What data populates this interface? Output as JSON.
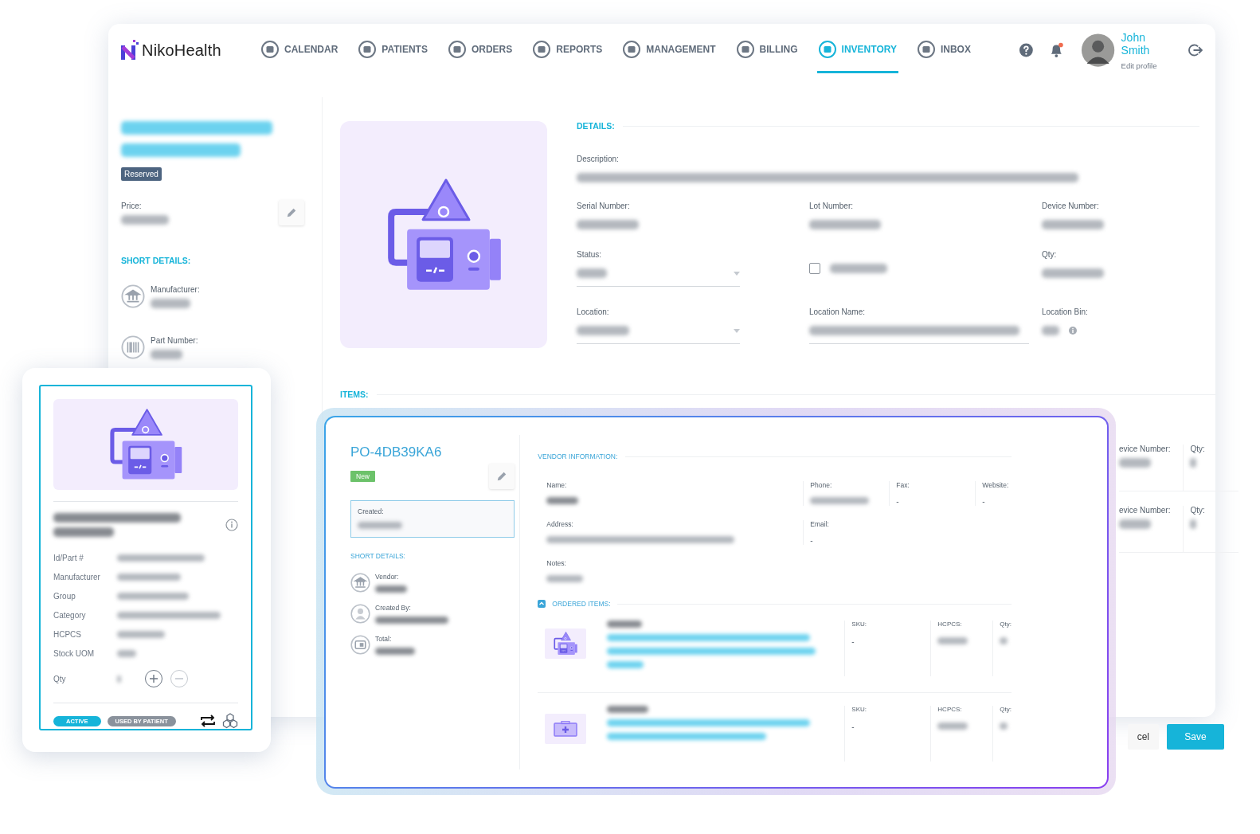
{
  "app": {
    "brand": "NikoHealth"
  },
  "nav": [
    {
      "label": "CALENDAR",
      "selected": false
    },
    {
      "label": "PATIENTS",
      "selected": false
    },
    {
      "label": "ORDERS",
      "selected": false
    },
    {
      "label": "REPORTS",
      "selected": false
    },
    {
      "label": "MANAGEMENT",
      "selected": false
    },
    {
      "label": "BILLING",
      "selected": false
    },
    {
      "label": "INVENTORY",
      "selected": true
    },
    {
      "label": "INBOX",
      "selected": false
    }
  ],
  "user": {
    "name": "John Smith",
    "link": "Edit profile",
    "has_notification": true
  },
  "product": {
    "status_badge": "Reserved",
    "price_label": "Price:",
    "short_details_title": "SHORT DETAILS:",
    "short_details": [
      {
        "label": "Manufacturer:"
      },
      {
        "label": "Part Number:"
      }
    ]
  },
  "details": {
    "title": "DETAILS:",
    "rows": [
      [
        {
          "kind": "text",
          "label": "Description:"
        }
      ],
      [
        {
          "kind": "text",
          "label": "Serial Number:"
        },
        {
          "kind": "text",
          "label": "Lot Number:"
        },
        {
          "kind": "text",
          "label": "Device Number:"
        }
      ],
      [
        {
          "kind": "select",
          "label": "Status:"
        },
        {
          "kind": "checkbox",
          "checked": false
        },
        {
          "kind": "text",
          "label": "Qty:"
        }
      ],
      [
        {
          "kind": "select",
          "label": "Location:"
        },
        {
          "kind": "input",
          "label": "Location Name:"
        },
        {
          "kind": "info",
          "label": "Location Bin:"
        }
      ]
    ]
  },
  "items": {
    "title": "ITEMS:",
    "rows": [
      {
        "device_label": "evice Number:",
        "qty_label": "Qty:"
      },
      {
        "device_label": "evice Number:",
        "qty_label": "Qty:"
      }
    ]
  },
  "footer": {
    "cancel": "cel",
    "save": "Save"
  },
  "item_card": {
    "fields": [
      {
        "label": "Id/Part #"
      },
      {
        "label": "Manufacturer"
      },
      {
        "label": "Group"
      },
      {
        "label": "Category"
      },
      {
        "label": "HCPCS"
      },
      {
        "label": "Stock UOM"
      }
    ],
    "qty_label": "Qty",
    "tags": [
      {
        "label": "ACTIVE",
        "color": "#16b4d9"
      },
      {
        "label": "USED BY PATIENT",
        "color": "#8a929c"
      }
    ]
  },
  "order": {
    "title": "PO-4DB39KA6",
    "badge": "New",
    "created_label": "Created:",
    "short_details_title": "SHORT DETAILS:",
    "short_details": [
      {
        "label": "Vendor:"
      },
      {
        "label": "Created By:"
      },
      {
        "label": "Total:"
      }
    ],
    "vendor_title": "VENDOR INFORMATION:",
    "vendor": {
      "name_label": "Name:",
      "phone_label": "Phone:",
      "fax_label": "Fax:",
      "fax": "-",
      "website_label": "Website:",
      "website": "-",
      "address_label": "Address:",
      "email_label": "Email:",
      "email": "-",
      "notes_label": "Notes:"
    },
    "ordered_title": "ORDERED ITEMS:",
    "ordered_expanded": true,
    "ordered_items": [
      {
        "sku_label": "SKU:",
        "sku": "-",
        "hcpcs_label": "HCPCS:",
        "qty_label": "Qty:"
      },
      {
        "sku_label": "SKU:",
        "sku": "-",
        "hcpcs_label": "HCPCS:",
        "qty_label": "Qty:"
      }
    ]
  }
}
